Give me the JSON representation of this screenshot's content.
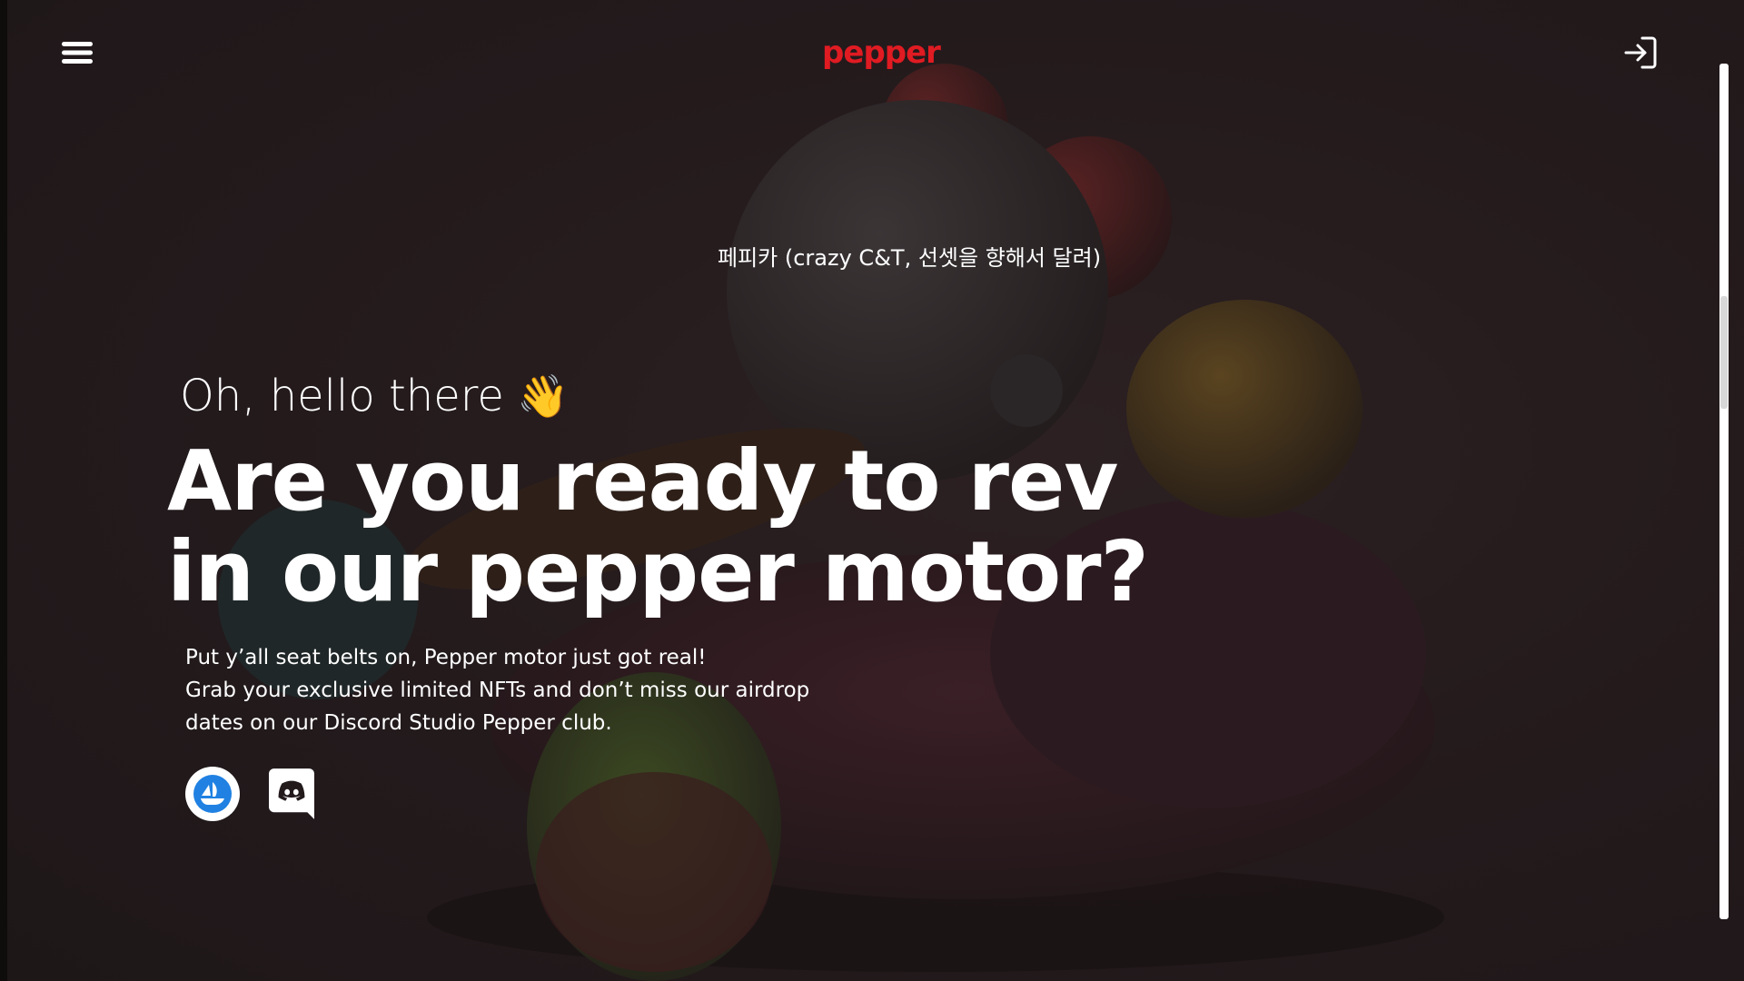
{
  "header": {
    "menu_icon": "hamburger-menu-icon",
    "logo_text": "pepper",
    "login_icon": "sign-in-icon"
  },
  "hero": {
    "korean_line": "페피카 (crazy C&T, 선셋을 향해서 달려)",
    "greeting": "Oh, hello there",
    "greeting_emoji": "👋",
    "headline_line1": "Are you ready to rev",
    "headline_line2": "in our pepper motor?",
    "subtext_line1": "Put y’all seat belts on, Pepper motor just got real!",
    "subtext_line2": "Grab your exclusive limited NFTs and don’t miss our airdrop",
    "subtext_line3": "dates on our Discord Studio Pepper club."
  },
  "social": {
    "opensea_icon": "opensea-icon",
    "discord_icon": "discord-icon"
  },
  "colors": {
    "background": "#221a1b",
    "brand": "#e01b22",
    "text": "#ffffff",
    "opensea_blue": "#2081e2"
  }
}
